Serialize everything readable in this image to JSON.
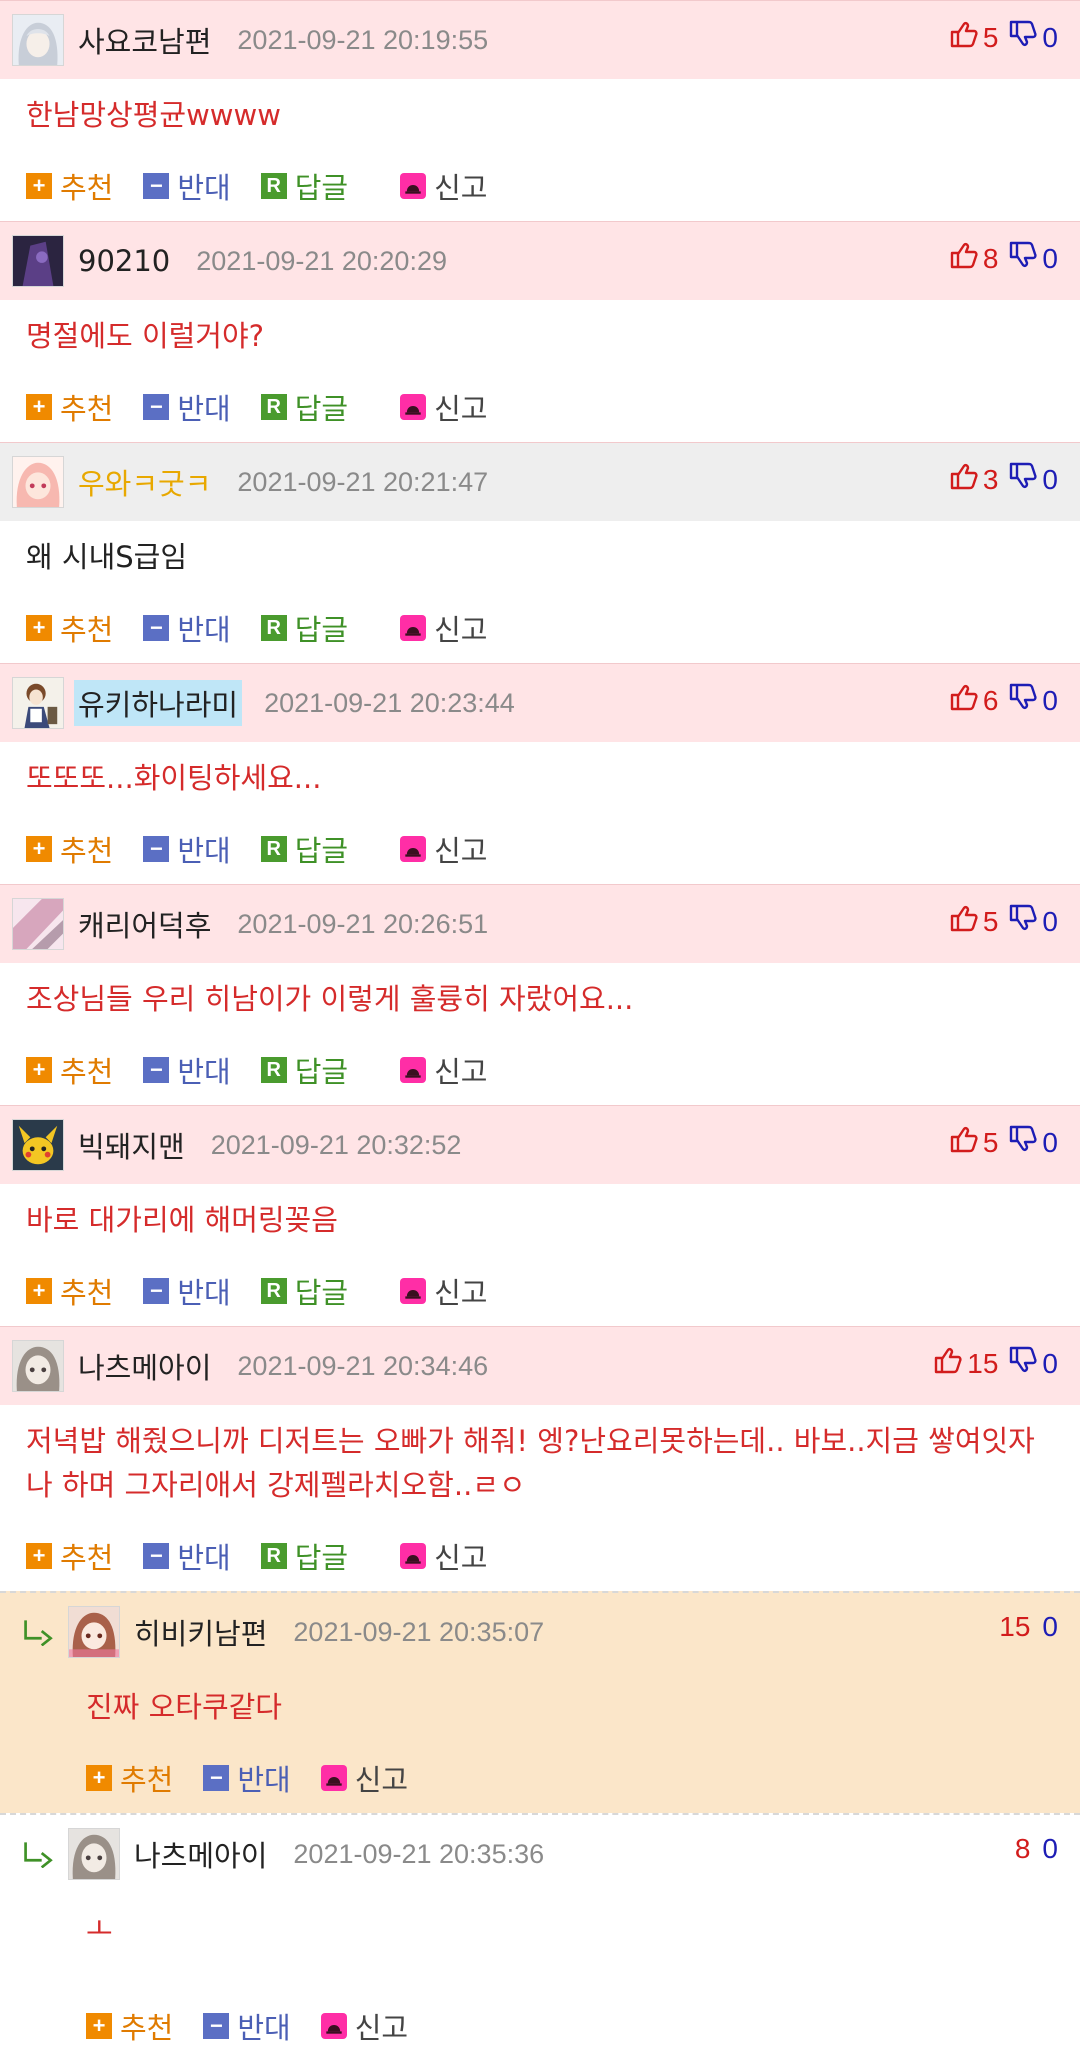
{
  "labels": {
    "recommend": "추천",
    "oppose": "반대",
    "reply": "답글",
    "report": "신고",
    "reply_box": "R"
  },
  "colors": {
    "header_pink": "#ffe4e6",
    "header_gray": "#eeeeee",
    "reply_bg": "#fbe6c9",
    "text_red": "#d52b2b",
    "up_red": "#d21c1c",
    "down_blue": "#1d1db5",
    "nick_gold": "#e8a800"
  },
  "comments": [
    {
      "nickname": "사요코남편",
      "date": "2021-09-21 20:19:55",
      "up": "5",
      "down": "0",
      "text": "한남망상평균wwww",
      "header": "pink",
      "avatar": "silver-hair-avatar"
    },
    {
      "nickname": "90210",
      "date": "2021-09-21 20:20:29",
      "up": "8",
      "down": "0",
      "text": "명절에도 이럴거야?",
      "header": "pink",
      "avatar": "dark-purple-avatar"
    },
    {
      "nickname": "우와ㅋ굿ㅋ",
      "date": "2021-09-21 20:21:47",
      "up": "3",
      "down": "0",
      "text": "왜 시내S급임",
      "header": "gray",
      "avatar": "pink-hair-avatar",
      "nick_style": "gold",
      "text_style": "black"
    },
    {
      "nickname": "유키하나라미",
      "date": "2021-09-21 20:23:44",
      "up": "6",
      "down": "0",
      "text": "또또또...화이팅하세요...",
      "header": "pink",
      "avatar": "maid-avatar",
      "nick_style": "highlight"
    },
    {
      "nickname": "캐리어덕후",
      "date": "2021-09-21 20:26:51",
      "up": "5",
      "down": "0",
      "text": "조상님들 우리 히남이가 이렇게 훌륭히 자랐어요...",
      "header": "pink",
      "avatar": "pink-blur-avatar"
    },
    {
      "nickname": "빅돼지맨",
      "date": "2021-09-21 20:32:52",
      "up": "5",
      "down": "0",
      "text": "바로 대가리에 해머링꽂음",
      "header": "pink",
      "avatar": "pikachu-avatar"
    },
    {
      "nickname": "나츠메아이",
      "date": "2021-09-21 20:34:46",
      "up": "15",
      "down": "0",
      "text": "저녁밥 해줬으니까 디저트는 오빠가 해줘! 엥?난요리못하는데.. 바보..지금 쌓여잇자나 하며 그자리애서 강제펠라치오함..ㄹㅇ",
      "header": "pink",
      "avatar": "gray-girl-avatar"
    }
  ],
  "replies": [
    {
      "nickname": "히비키남편",
      "date": "2021-09-21 20:35:07",
      "up": "15",
      "down": "0",
      "text": "진짜 오타쿠같다",
      "avatar": "brown-hair-avatar"
    },
    {
      "nickname": "나츠메아이",
      "date": "2021-09-21 20:35:36",
      "up": "8",
      "down": "0",
      "text": "ㅗ",
      "avatar": "gray-girl-avatar"
    }
  ]
}
